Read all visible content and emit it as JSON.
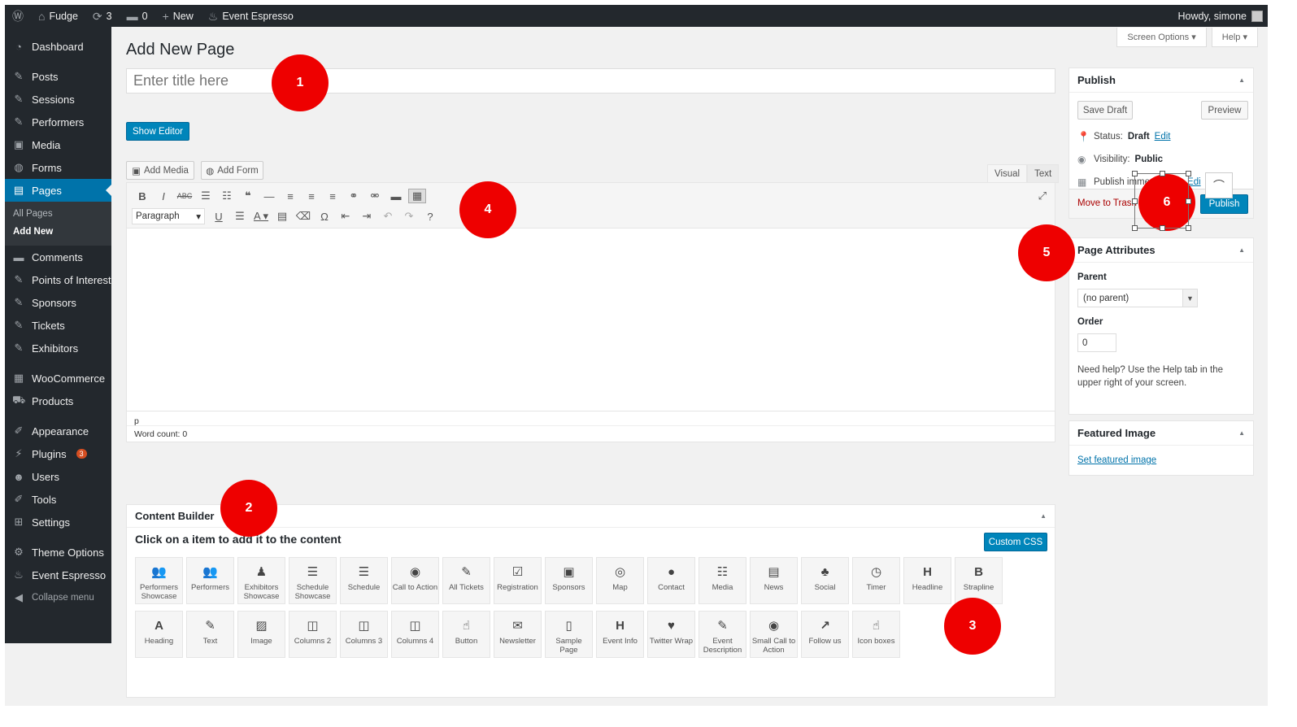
{
  "adminbar": {
    "site": "Fudge",
    "updates": "3",
    "comments": "0",
    "new": "New",
    "plugin": "Event Espresso",
    "howdy": "Howdy, simone"
  },
  "sidebar": {
    "items": [
      {
        "label": "Dashboard",
        "icon": "dashboard-icon"
      },
      {
        "label": "Posts",
        "icon": "pin-icon"
      },
      {
        "label": "Sessions",
        "icon": "pin-icon"
      },
      {
        "label": "Performers",
        "icon": "pin-icon"
      },
      {
        "label": "Media",
        "icon": "media-icon"
      },
      {
        "label": "Forms",
        "icon": "forms-icon"
      },
      {
        "label": "Pages",
        "icon": "pages-icon"
      },
      {
        "label": "Comments",
        "icon": "comment-icon"
      },
      {
        "label": "Points of Interest",
        "icon": "pin-icon"
      },
      {
        "label": "Sponsors",
        "icon": "pin-icon"
      },
      {
        "label": "Tickets",
        "icon": "pin-icon"
      },
      {
        "label": "Exhibitors",
        "icon": "pin-icon"
      },
      {
        "label": "WooCommerce",
        "icon": "woo-icon"
      },
      {
        "label": "Products",
        "icon": "cart-icon"
      },
      {
        "label": "Appearance",
        "icon": "brush-icon"
      },
      {
        "label": "Plugins",
        "icon": "plugin-icon",
        "badge": "3"
      },
      {
        "label": "Users",
        "icon": "user-icon"
      },
      {
        "label": "Tools",
        "icon": "wrench-icon"
      },
      {
        "label": "Settings",
        "icon": "settings-icon"
      },
      {
        "label": "Theme Options",
        "icon": "gear-icon"
      },
      {
        "label": "Event Espresso",
        "icon": "espresso-icon"
      }
    ],
    "submenu": [
      "All Pages",
      "Add New"
    ],
    "collapse": "Collapse menu"
  },
  "header": {
    "title": "Add New Page",
    "screen_options": "Screen Options",
    "help": "Help"
  },
  "editor": {
    "title_placeholder": "Enter title here",
    "show_editor": "Show Editor",
    "add_media": "Add Media",
    "add_form": "Add Form",
    "tab_visual": "Visual",
    "tab_text": "Text",
    "format_select": "Paragraph",
    "path": "p",
    "word_count": "Word count: 0"
  },
  "content_builder": {
    "title": "Content Builder",
    "instruction": "Click on a item to add it to the content",
    "custom_css": "Custom CSS",
    "tiles": [
      {
        "label": "Performers Showcase",
        "icon": "👥"
      },
      {
        "label": "Performers",
        "icon": "👥"
      },
      {
        "label": "Exhibitors Showcase",
        "icon": "♟"
      },
      {
        "label": "Schedule Showcase",
        "icon": "☰"
      },
      {
        "label": "Schedule",
        "icon": "☰"
      },
      {
        "label": "Call to Action",
        "icon": "◉"
      },
      {
        "label": "All Tickets",
        "icon": "✎"
      },
      {
        "label": "Registration",
        "icon": "☑"
      },
      {
        "label": "Sponsors",
        "icon": "▣"
      },
      {
        "label": "Map",
        "icon": "◎"
      },
      {
        "label": "Contact",
        "icon": "●"
      },
      {
        "label": "Media",
        "icon": "☷"
      },
      {
        "label": "News",
        "icon": "▤"
      },
      {
        "label": "Social",
        "icon": "♣"
      },
      {
        "label": "Timer",
        "icon": "◷"
      },
      {
        "label": "Headline",
        "icon": "H"
      },
      {
        "label": "Strapline",
        "icon": "B"
      },
      {
        "label": "Heading",
        "icon": "A"
      },
      {
        "label": "Text",
        "icon": "✎"
      },
      {
        "label": "Image",
        "icon": "▨"
      },
      {
        "label": "Columns 2",
        "icon": "◫"
      },
      {
        "label": "Columns 3",
        "icon": "◫"
      },
      {
        "label": "Columns 4",
        "icon": "◫"
      },
      {
        "label": "Button",
        "icon": "☝"
      },
      {
        "label": "Newsletter",
        "icon": "✉"
      },
      {
        "label": "Sample Page",
        "icon": "▯"
      },
      {
        "label": "Event Info",
        "icon": "H"
      },
      {
        "label": "Twitter Wrap",
        "icon": "♥"
      },
      {
        "label": "Event Description",
        "icon": "✎"
      },
      {
        "label": "Small Call to Action",
        "icon": "◉"
      },
      {
        "label": "Follow us",
        "icon": "↗"
      },
      {
        "label": "Icon boxes",
        "icon": "☝"
      }
    ]
  },
  "publish": {
    "title": "Publish",
    "save_draft": "Save Draft",
    "preview": "Preview",
    "status_label": "Status:",
    "status_value": "Draft",
    "edit": "Edit",
    "visibility_label": "Visibility:",
    "visibility_value": "Public",
    "publish_label": "Publish imme",
    "edit_partial": "Edi",
    "trash": "Move to Trash",
    "publish_btn": "Publish"
  },
  "page_attributes": {
    "title": "Page Attributes",
    "parent_label": "Parent",
    "parent_value": "(no parent)",
    "order_label": "Order",
    "order_value": "0",
    "help": "Need help? Use the Help tab in the upper right of your screen."
  },
  "featured_image": {
    "title": "Featured Image",
    "link": "Set featured image"
  },
  "markers": [
    "1",
    "2",
    "3",
    "4",
    "5",
    "6"
  ],
  "colors": {
    "accent": "#0073aa",
    "marker": "#ee0000",
    "sidebar": "#23282d"
  }
}
